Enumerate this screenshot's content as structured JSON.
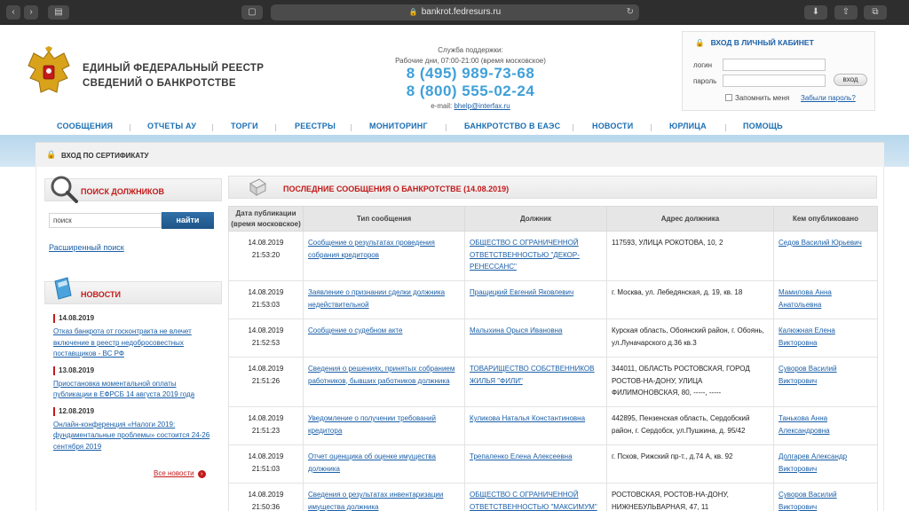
{
  "browser": {
    "url": "bankrot.fedresurs.ru"
  },
  "brand": {
    "line1": "ЕДИНЫЙ ФЕДЕРАЛЬНЫЙ РЕЕСТР",
    "line2": "СВЕДЕНИЙ О БАНКРОТСТВЕ"
  },
  "support": {
    "title": "Служба поддержки:",
    "hours": "Рабочие дни, 07:00-21:00 (время московское)",
    "phone1": "8 (495) 989-73-68",
    "phone2": "8 (800) 555-02-24",
    "email_label": "e-mail:",
    "email": "bhelp@interfax.ru"
  },
  "login": {
    "title": "ВХОД В ЛИЧНЫЙ КАБИНЕТ",
    "login_label": "логин",
    "password_label": "пароль",
    "enter": "вход",
    "remember": "Запомнить меня",
    "forgot": "Забыли пароль?"
  },
  "nav": [
    "СООБЩЕНИЯ",
    "ОТЧЕТЫ АУ",
    "ТОРГИ",
    "РЕЕСТРЫ",
    "МОНИТОРИНГ",
    "БАНКРОТСТВО В ЕАЭС",
    "НОВОСТИ",
    "ЮРЛИЦА",
    "ПОМОЩЬ"
  ],
  "cert": "ВХОД ПО СЕРТИФИКАТУ",
  "search": {
    "title": "ПОИСК ДОЛЖНИКОВ",
    "placeholder": "поиск",
    "button": "найти",
    "advanced": "Расширенный поиск"
  },
  "news": {
    "title": "НОВОСТИ",
    "items": [
      {
        "date": "14.08.2019",
        "text": "Отказ банкрота от госконтракта не влечет включение в реестр недобросовестных поставщиков - ВС РФ"
      },
      {
        "date": "13.08.2019",
        "text": "Приостановка моментальной оплаты публикации в ЕФРСБ 14 августа 2019 года"
      },
      {
        "date": "12.08.2019",
        "text": "Онлайн-конференция «Налоги 2019: фундаментальные проблемы» состоится 24-26 сентября 2019"
      }
    ],
    "all": "Все новости"
  },
  "messages": {
    "title": "ПОСЛЕДНИЕ СООБЩЕНИЯ О БАНКРОТСТВЕ (14.08.2019)",
    "columns": [
      "Дата публикации (время московское)",
      "Тип сообщения",
      "Должник",
      "Адрес должника",
      "Кем опубликовано"
    ],
    "rows": [
      {
        "date": "14.08.2019",
        "time": "21:53:20",
        "type": "Сообщение о результатах проведения собрания кредиторов",
        "debtor": "ОБЩЕСТВО С ОГРАНИЧЕННОЙ ОТВЕТСТВЕННОСТЬЮ \"ДЕКОР-РЕНЕССАНС\"",
        "address": "117593, УЛИЦА РОКОТОВА, 10, 2",
        "publisher": "Седов Василий Юрьевич"
      },
      {
        "date": "14.08.2019",
        "time": "21:53:03",
        "type": "Заявление о признании сделки должника недействительной",
        "debtor": "Пращицкий Евгений Яковлевич",
        "address": "г. Москва, ул. Лебедянская, д. 19, кв. 18",
        "publisher": "Мамилова Анна Анатольевна"
      },
      {
        "date": "14.08.2019",
        "time": "21:52:53",
        "type": "Сообщение о судебном акте",
        "debtor": "Малыхина Орыся Ивановна",
        "address": "Курская область, Обоянский район, г. Обоянь, ул.Луначарского д.36 кв.3",
        "publisher": "Калюжная Елена Викторовна"
      },
      {
        "date": "14.08.2019",
        "time": "21:51:26",
        "type": "Сведения о решениях, принятых собранием работников, бывших работников должника",
        "debtor": "ТОВАРИЩЕСТВО СОБСТВЕННИКОВ ЖИЛЬЯ \"ФИЛИ\"",
        "address": "344011, ОБЛАСТЬ РОСТОВСКАЯ, ГОРОД РОСТОВ-НА-ДОНУ, УЛИЦА ФИЛИМОНОВСКАЯ, 80, -----, -----",
        "publisher": "Суворов Василий Викторович"
      },
      {
        "date": "14.08.2019",
        "time": "21:51:23",
        "type": "Уведомление о получении требований кредитора",
        "debtor": "Куликова Наталья Константиновна",
        "address": "442895, Пензенская область, Сердобский район, г. Сердобск, ул.Пушкина, д. 95/42",
        "publisher": "Танькова Анна Александровна"
      },
      {
        "date": "14.08.2019",
        "time": "21:51:03",
        "type": "Отчет оценщика об оценке имущества должника",
        "debtor": "Трепаленко Елена Алексеевна",
        "address": "г. Псков, Рижский пр-т., д.74 А, кв. 92",
        "publisher": "Долгарев Александр Викторович"
      },
      {
        "date": "14.08.2019",
        "time": "21:50:36",
        "type": "Сведения о результатах инвентаризации имущества должника",
        "debtor": "ОБЩЕСТВО С ОГРАНИЧЕННОЙ ОТВЕТСТВЕННОСТЬЮ \"МАКСИМУМ\"",
        "address": "РОСТОВСКАЯ, РОСТОВ-НА-ДОНУ, НИЖНЕБУЛЬВАРНАЯ, 47, 11",
        "publisher": "Суворов Василий Викторович"
      }
    ]
  }
}
